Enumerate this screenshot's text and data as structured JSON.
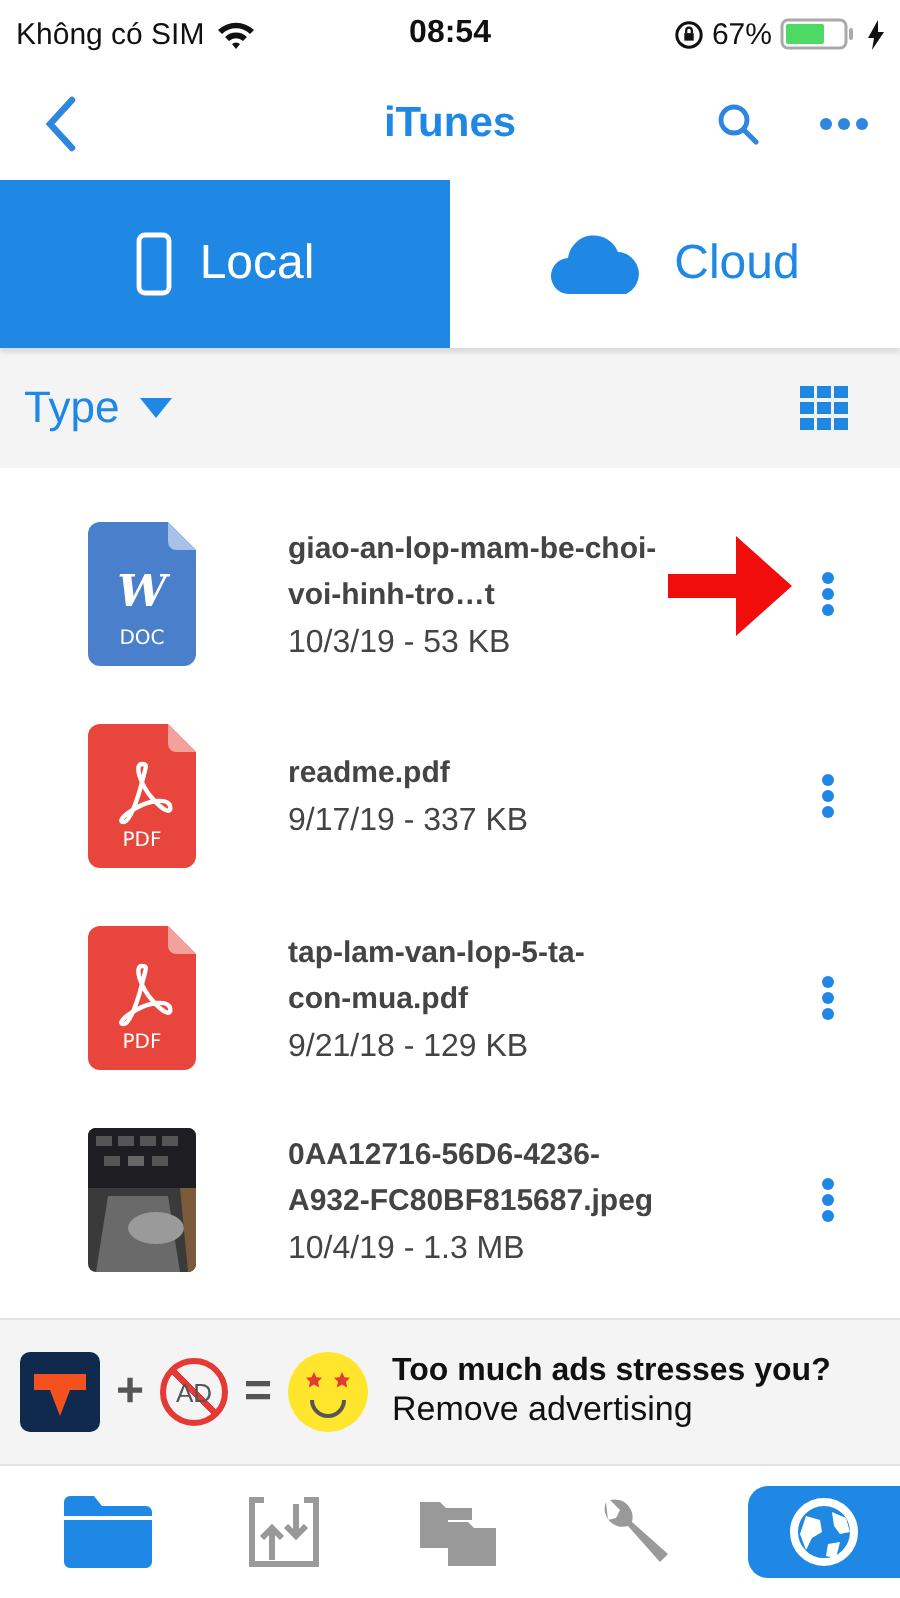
{
  "status_bar": {
    "carrier": "Không có SIM",
    "time": "08:54",
    "battery": "67%"
  },
  "nav": {
    "title": "iTunes"
  },
  "tabs": [
    {
      "label": "Local",
      "kind": "phone",
      "selected": true
    },
    {
      "label": "Cloud",
      "kind": "cloud",
      "selected": false
    }
  ],
  "filter": {
    "label": "Type"
  },
  "files": [
    {
      "kind": "doc",
      "icon_letter": "W",
      "icon_label": "DOC",
      "name_lines": [
        "giao-an-lop-mam-be-choi-",
        "voi-hinh-tro…t"
      ],
      "meta": "10/3/19 - 53 KB",
      "annotated": true
    },
    {
      "kind": "pdf",
      "icon_label": "PDF",
      "name_lines": [
        "readme.pdf"
      ],
      "meta": "9/17/19 - 337 KB",
      "annotated": false
    },
    {
      "kind": "pdf",
      "icon_label": "PDF",
      "name_lines": [
        "tap-lam-van-lop-5-ta-",
        "con-mua.pdf"
      ],
      "meta": "9/21/18 - 129 KB",
      "annotated": false
    },
    {
      "kind": "picture",
      "name_lines": [
        "0AA12716-56D6-4236-",
        "A932-FC80BF815687.jpeg"
      ],
      "meta": "10/4/19 - 1.3 MB",
      "annotated": false
    }
  ],
  "ad": {
    "plus": "+",
    "no_ad": "AD",
    "equals": "=",
    "headline": "Too much ads stresses you?",
    "action": "Remove advertising"
  },
  "bottom_tabs": [
    {
      "kind": "folder",
      "selected": false
    },
    {
      "kind": "transfer",
      "selected": false
    },
    {
      "kind": "folders",
      "selected": false
    },
    {
      "kind": "wrench",
      "selected": false
    },
    {
      "kind": "globe",
      "selected": true
    }
  ]
}
